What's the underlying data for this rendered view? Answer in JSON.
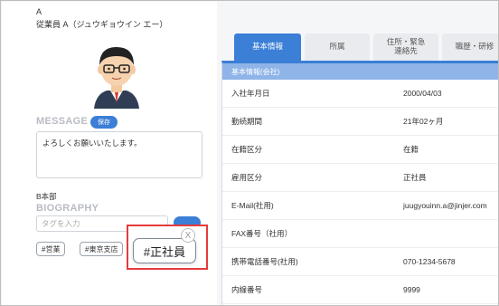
{
  "employee": {
    "initial": "A",
    "name": "従業員 A（ジュウギョウイン エー）",
    "department": "B本部"
  },
  "message": {
    "label": "MESSAGE",
    "save_label": "保存",
    "text": "よろしくお願いいたします。"
  },
  "biography": {
    "label": "BIOGRAPHY",
    "tag_placeholder": "タグを入力",
    "add_label": "",
    "tags": [
      "#営業",
      "#東京支店"
    ]
  },
  "popup": {
    "tag": "#正社員",
    "close_label": "X"
  },
  "tabs": [
    {
      "label": "基本情報"
    },
    {
      "label": "所属"
    },
    {
      "label": "住所・緊急\n連絡先"
    },
    {
      "label": "職歴・研修"
    }
  ],
  "panel": {
    "header": "基本情報(会社)",
    "rows": [
      {
        "key": "入社年月日",
        "value": "2000/04/03"
      },
      {
        "key": "勤続期間",
        "value": "21年02ヶ月"
      },
      {
        "key": "在籍区分",
        "value": "在籍"
      },
      {
        "key": "雇用区分",
        "value": "正社員"
      },
      {
        "key": "E-Mail(社用)",
        "value": "juugyouinn.a@jinjer.com"
      },
      {
        "key": "FAX番号（社用）",
        "value": ""
      },
      {
        "key": "携帯電話番号(社用)",
        "value": "070-1234-5678"
      },
      {
        "key": "内線番号",
        "value": "9999"
      }
    ]
  },
  "colors": {
    "accent": "#3b7fd6",
    "panel_header": "#8fb4e8",
    "highlight": "#e53b3b"
  }
}
